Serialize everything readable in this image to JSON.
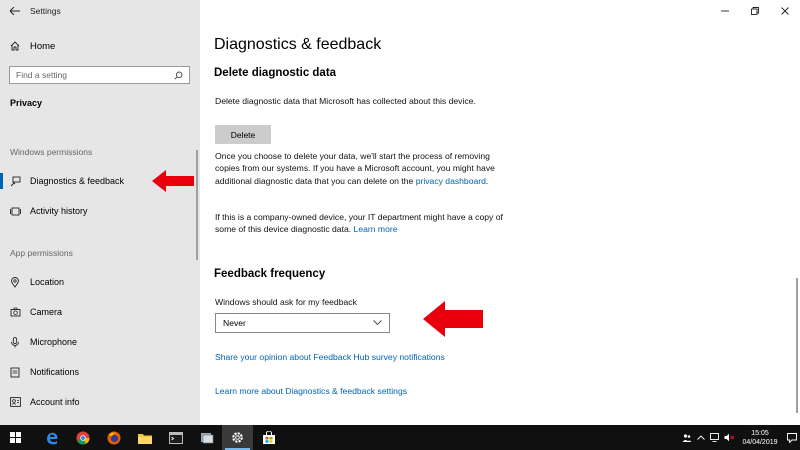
{
  "window": {
    "title": "Settings",
    "controls": [
      "minimize",
      "restore",
      "close"
    ]
  },
  "sidebar": {
    "home_label": "Home",
    "search_placeholder": "Find a setting",
    "section": "Privacy",
    "group_windows_permissions": "Windows permissions",
    "group_app_permissions": "App permissions",
    "items": [
      {
        "label": "Diagnostics & feedback",
        "icon": "feedback-icon",
        "selected": true
      },
      {
        "label": "Activity history",
        "icon": "activity-history-icon",
        "selected": false
      },
      {
        "label": "Location",
        "icon": "location-icon",
        "selected": false
      },
      {
        "label": "Camera",
        "icon": "camera-icon",
        "selected": false
      },
      {
        "label": "Microphone",
        "icon": "microphone-icon",
        "selected": false
      },
      {
        "label": "Notifications",
        "icon": "notifications-icon",
        "selected": false
      },
      {
        "label": "Account info",
        "icon": "account-info-icon",
        "selected": false
      }
    ]
  },
  "main": {
    "page_title": "Diagnostics & feedback",
    "delete_section": {
      "heading": "Delete diagnostic data",
      "description": "Delete diagnostic data that Microsoft has collected about this device.",
      "button_label": "Delete",
      "info_text": "Once you choose to delete your data, we'll start the process of removing copies from our systems. If you have a Microsoft account, you might have additional diagnostic data that you can delete on the",
      "info_link": "privacy dashboard",
      "info_end": ".",
      "company_text": "If this is a company-owned device, your IT department might have a copy of some of this device diagnostic data.",
      "company_link": "Learn more"
    },
    "feedback_section": {
      "heading": "Feedback frequency",
      "dropdown_label": "Windows should ask for my feedback",
      "dropdown_value": "Never",
      "link_survey": "Share your opinion about Feedback Hub survey notifications",
      "link_learn_more": "Learn more about Diagnostics & feedback settings"
    }
  },
  "taskbar": {
    "icons": [
      "windows-start-icon",
      "edge-icon",
      "chrome-icon",
      "firefox-icon",
      "file-explorer-icon",
      "terminal-icon",
      "snipping-tool-icon",
      "settings-icon",
      "store-icon"
    ],
    "clock_time": "15:05",
    "clock_date": "04/04/2019"
  },
  "colors": {
    "sidebar_bg": "#e6e6e6",
    "accent": "#0063b1",
    "arrow": "#e8000b",
    "taskbar_bg": "#101010"
  }
}
